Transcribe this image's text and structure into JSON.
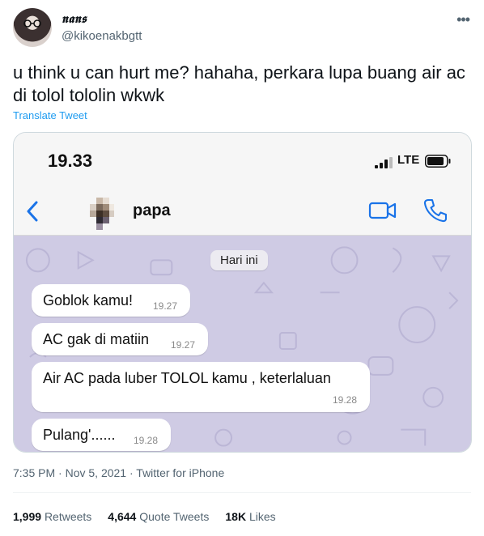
{
  "author": {
    "display_name": "𝖓𝖆𝖓𝖘",
    "handle": "@kikoenakbgtt"
  },
  "tweet": {
    "text": "u think u can hurt me? hahaha, perkara lupa buang air ac di tolol tololin wkwk",
    "translate_label": "Translate Tweet",
    "time": "7:35 PM",
    "date": "Nov 5, 2021",
    "source": "Twitter for iPhone"
  },
  "phone": {
    "clock": "19.33",
    "network": "LTE",
    "contact_name": "papa",
    "date_chip": "Hari ini",
    "messages": [
      {
        "text": "Goblok kamu!",
        "time": "19.27"
      },
      {
        "text": "AC gak di matiin",
        "time": "19.27"
      },
      {
        "text": "Air AC  pada luber TOLOL kamu , keterlaluan",
        "time": "19.28"
      },
      {
        "text": "Pulang'......",
        "time": "19.28"
      }
    ]
  },
  "stats": {
    "retweets_count": "1,999",
    "retweets_label": "Retweets",
    "quotes_count": "4,644",
    "quotes_label": "Quote Tweets",
    "likes_count": "18K",
    "likes_label": "Likes"
  },
  "colors": {
    "link": "#1d9bf0",
    "ios_blue": "#1a73e8",
    "chat_background": "#cfcbe4",
    "text_secondary": "#536471"
  },
  "icons": [
    "more-icon",
    "back-icon",
    "video-call-icon",
    "phone-call-icon",
    "signal-icon",
    "battery-icon"
  ]
}
